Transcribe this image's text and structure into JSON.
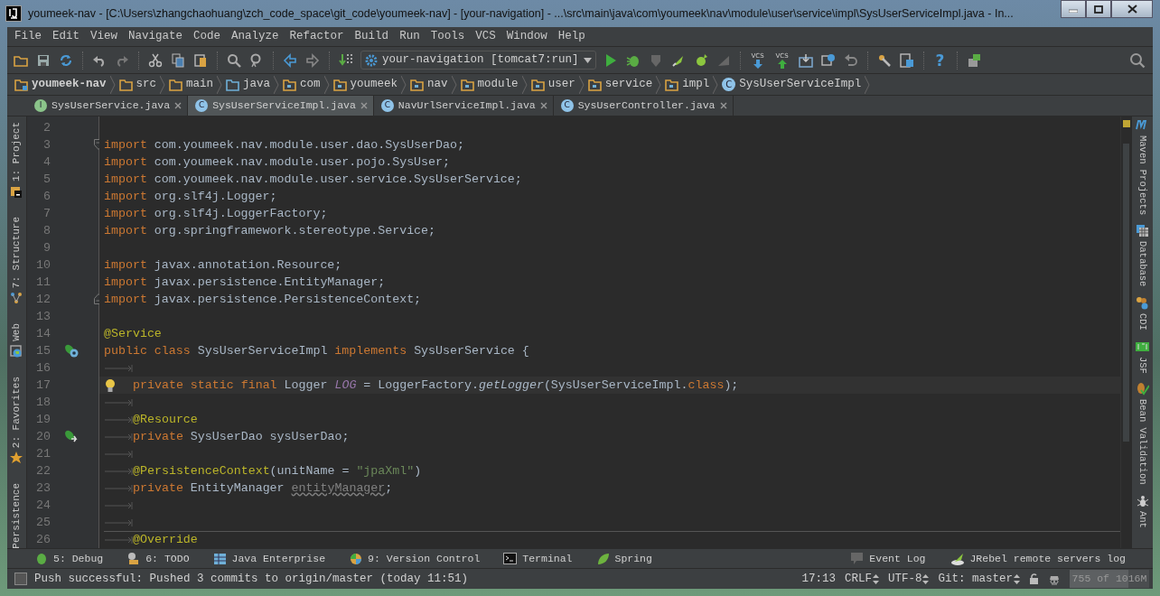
{
  "window": {
    "title": "youmeek-nav - [C:\\Users\\zhangchaohuang\\zch_code_space\\git_code\\youmeek-nav] - [your-navigation] - ...\\src\\main\\java\\com\\youmeek\\nav\\module\\user\\service\\impl\\SysUserServiceImpl.java - In..."
  },
  "menu": [
    "File",
    "Edit",
    "View",
    "Navigate",
    "Code",
    "Analyze",
    "Refactor",
    "Build",
    "Run",
    "Tools",
    "VCS",
    "Window",
    "Help"
  ],
  "toolbar": {
    "items": [
      {
        "kind": "open"
      },
      {
        "kind": "save"
      },
      {
        "kind": "sync"
      },
      {
        "kind": "sep"
      },
      {
        "kind": "undo"
      },
      {
        "kind": "redo"
      },
      {
        "kind": "sep"
      },
      {
        "kind": "cut"
      },
      {
        "kind": "copy"
      },
      {
        "kind": "paste"
      },
      {
        "kind": "sep"
      },
      {
        "kind": "find"
      },
      {
        "kind": "replace"
      },
      {
        "kind": "sep"
      },
      {
        "kind": "back"
      },
      {
        "kind": "forward"
      },
      {
        "kind": "sep"
      },
      {
        "kind": "make"
      },
      {
        "kind": "runconfig",
        "label": "your-navigation [tomcat7:run]"
      },
      {
        "kind": "run"
      },
      {
        "kind": "debug"
      },
      {
        "kind": "coverage"
      },
      {
        "kind": "jrebel-run"
      },
      {
        "kind": "jrebel-debug"
      },
      {
        "kind": "stop"
      },
      {
        "kind": "sep"
      },
      {
        "kind": "vcs-update",
        "label": "VCS"
      },
      {
        "kind": "vcs-commit",
        "label": "VCS"
      },
      {
        "kind": "compare"
      },
      {
        "kind": "history"
      },
      {
        "kind": "revert"
      },
      {
        "kind": "sep"
      },
      {
        "kind": "settings"
      },
      {
        "kind": "structure"
      },
      {
        "kind": "sep"
      },
      {
        "kind": "help",
        "label": "?"
      },
      {
        "kind": "sep"
      },
      {
        "kind": "sdk"
      }
    ]
  },
  "breadcrumb": [
    {
      "label": "youmeek-nav",
      "kind": "module"
    },
    {
      "label": "src",
      "kind": "folder"
    },
    {
      "label": "main",
      "kind": "folder"
    },
    {
      "label": "java",
      "kind": "source"
    },
    {
      "label": "com",
      "kind": "package"
    },
    {
      "label": "youmeek",
      "kind": "package"
    },
    {
      "label": "nav",
      "kind": "package"
    },
    {
      "label": "module",
      "kind": "package"
    },
    {
      "label": "user",
      "kind": "package"
    },
    {
      "label": "service",
      "kind": "package"
    },
    {
      "label": "impl",
      "kind": "package"
    },
    {
      "label": "SysUserServiceImpl",
      "kind": "class",
      "badge": "C"
    }
  ],
  "tabs": [
    {
      "label": "SysUserService.java",
      "badge": "I",
      "kind": "interface",
      "selected": false
    },
    {
      "label": "SysUserServiceImpl.java",
      "badge": "C",
      "kind": "class",
      "selected": true
    },
    {
      "label": "NavUrlServiceImpl.java",
      "badge": "C",
      "kind": "class",
      "selected": false
    },
    {
      "label": "SysUserController.java",
      "badge": "C",
      "kind": "class",
      "selected": false
    }
  ],
  "left_tools": [
    {
      "label": "1: Project",
      "kind": "project"
    },
    {
      "label": "7: Structure",
      "kind": "structure"
    },
    {
      "label": "Web",
      "kind": "web"
    },
    {
      "label": "2: Favorites",
      "kind": "favorites"
    },
    {
      "label": "Persistence",
      "kind": "persistence"
    }
  ],
  "right_tools": [
    {
      "label": "Maven Projects",
      "kind": "maven"
    },
    {
      "label": "Database",
      "kind": "database"
    },
    {
      "label": "CDI",
      "kind": "cdi"
    },
    {
      "label": "JSF",
      "kind": "jsf"
    },
    {
      "label": "Bean Validation",
      "kind": "bean"
    },
    {
      "label": "Ant",
      "kind": "ant"
    }
  ],
  "editor": {
    "lines": [
      {
        "number": "2"
      },
      {
        "number": "3",
        "fold_start": true,
        "tokens": [
          {
            "kind": "kw",
            "text": "import "
          },
          {
            "kind": "plain",
            "text": "com.youmeek.nav.module.user.dao.SysUserDao;"
          }
        ]
      },
      {
        "number": "4",
        "tokens": [
          {
            "kind": "kw",
            "text": "import "
          },
          {
            "kind": "plain",
            "text": "com.youmeek.nav.module.user.pojo.SysUser;"
          }
        ]
      },
      {
        "number": "5",
        "tokens": [
          {
            "kind": "kw",
            "text": "import "
          },
          {
            "kind": "plain",
            "text": "com.youmeek.nav.module.user.service.SysUserService;"
          }
        ]
      },
      {
        "number": "6",
        "tokens": [
          {
            "kind": "kw",
            "text": "import "
          },
          {
            "kind": "plain",
            "text": "org.slf4j.Logger;"
          }
        ]
      },
      {
        "number": "7",
        "tokens": [
          {
            "kind": "kw",
            "text": "import "
          },
          {
            "kind": "plain",
            "text": "org.slf4j.LoggerFactory;"
          }
        ]
      },
      {
        "number": "8",
        "tokens": [
          {
            "kind": "kw",
            "text": "import "
          },
          {
            "kind": "plain",
            "text": "org.springframework.stereotype.Service;"
          }
        ]
      },
      {
        "number": "9"
      },
      {
        "number": "10",
        "tokens": [
          {
            "kind": "kw",
            "text": "import "
          },
          {
            "kind": "plain",
            "text": "javax.annotation.Resource;"
          }
        ]
      },
      {
        "number": "11",
        "tokens": [
          {
            "kind": "kw",
            "text": "import "
          },
          {
            "kind": "plain",
            "text": "javax.persistence.EntityManager;"
          }
        ]
      },
      {
        "number": "12",
        "fold_end": true,
        "tokens": [
          {
            "kind": "kw",
            "text": "import "
          },
          {
            "kind": "plain",
            "text": "javax.persistence.PersistenceContext;"
          }
        ]
      },
      {
        "number": "13"
      },
      {
        "number": "14",
        "tokens": [
          {
            "kind": "ann",
            "text": "@Service"
          }
        ]
      },
      {
        "number": "15",
        "implements_marker": true,
        "tokens": [
          {
            "kind": "kw",
            "text": "public class "
          },
          {
            "kind": "plain",
            "text": "SysUserServiceImpl "
          },
          {
            "kind": "kw",
            "text": "implements "
          },
          {
            "kind": "plain",
            "text": "SysUserService {"
          }
        ]
      },
      {
        "number": "16",
        "tab": true
      },
      {
        "number": "17",
        "tab": true,
        "current": true,
        "bulb": true,
        "tokens": [
          {
            "kind": "kw",
            "text": "private static final "
          },
          {
            "kind": "plain",
            "text": "Logger "
          },
          {
            "kind": "static-field",
            "text": "LOG"
          },
          {
            "kind": "plain",
            "text": " = LoggerFactory."
          },
          {
            "kind": "static-method",
            "text": "getLogger"
          },
          {
            "kind": "plain",
            "text": "(SysUserServiceImpl."
          },
          {
            "kind": "kw",
            "text": "class"
          },
          {
            "kind": "plain",
            "text": ");"
          }
        ]
      },
      {
        "number": "18",
        "tab": true
      },
      {
        "number": "19",
        "tab": true,
        "tokens": [
          {
            "kind": "ann",
            "text": "@Resource"
          }
        ]
      },
      {
        "number": "20",
        "tab": true,
        "injection_marker": true,
        "tokens": [
          {
            "kind": "kw",
            "text": "private "
          },
          {
            "kind": "plain",
            "text": "SysUserDao sysUserDao;"
          }
        ]
      },
      {
        "number": "21",
        "tab": true
      },
      {
        "number": "22",
        "tab": true,
        "tokens": [
          {
            "kind": "ann",
            "text": "@PersistenceContext"
          },
          {
            "kind": "plain",
            "text": "(unitName = "
          },
          {
            "kind": "str",
            "text": "\"jpaXml\""
          },
          {
            "kind": "plain",
            "text": ")"
          }
        ]
      },
      {
        "number": "23",
        "tab": true,
        "tokens": [
          {
            "kind": "kw",
            "text": "private "
          },
          {
            "kind": "plain",
            "text": "EntityManager "
          },
          {
            "kind": "unused",
            "text": "entityManager"
          },
          {
            "kind": "plain",
            "text": ";"
          }
        ]
      },
      {
        "number": "24",
        "tab": true
      },
      {
        "number": "25",
        "tab": true
      },
      {
        "number": "26",
        "tab": true,
        "separator": true,
        "tokens": [
          {
            "kind": "ann",
            "text": "@Override"
          }
        ]
      }
    ]
  },
  "bottom_tools": [
    {
      "label": "5: Debug",
      "kind": "debug"
    },
    {
      "label": "6: TODO",
      "kind": "todo"
    },
    {
      "label": "Java Enterprise",
      "kind": "javaee"
    },
    {
      "label": "9: Version Control",
      "kind": "vcs"
    },
    {
      "label": "Terminal",
      "kind": "terminal"
    },
    {
      "label": "Spring",
      "kind": "spring"
    }
  ],
  "bottom_tools_right": [
    {
      "label": "Event Log",
      "kind": "eventlog"
    },
    {
      "label": "JRebel remote servers log",
      "kind": "jrebel"
    }
  ],
  "status_bar": {
    "message": "Push successful: Pushed 3 commits to origin/master (today 11:51)",
    "position": "17:13",
    "line_separator": "CRLF",
    "encoding": "UTF-8",
    "branch": "Git: master",
    "memory": {
      "text": "755 of 1016M",
      "level": 0.74
    }
  }
}
